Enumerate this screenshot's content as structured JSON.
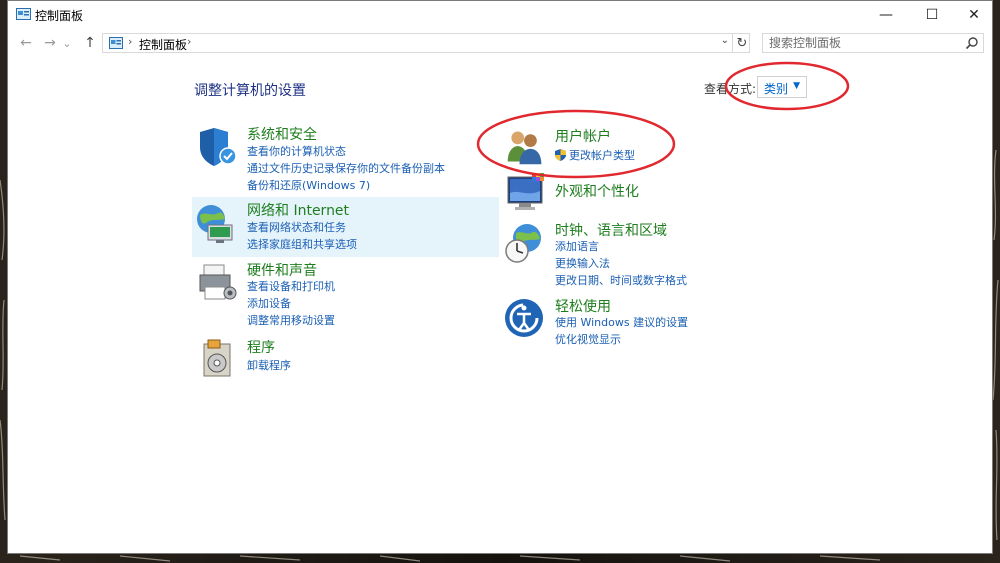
{
  "window": {
    "title": "控制面板",
    "controls": {
      "minimize": "—",
      "maximize": "☐",
      "close": "✕"
    }
  },
  "nav": {
    "back": "←",
    "forward": "→",
    "recent": "⌄",
    "up": "↑",
    "address_text": "控制面板",
    "address_chevron": "›",
    "dropdown": "⌄",
    "refresh": "↻",
    "search_placeholder": "搜索控制面板"
  },
  "main": {
    "heading": "调整计算机的设置",
    "view_by_label": "查看方式:",
    "view_by_value": "类别",
    "view_by_arrow": "▼"
  },
  "categories_left": [
    {
      "title": "系统和安全",
      "icon": "shield-icon",
      "links": [
        "查看你的计算机状态",
        "通过文件历史记录保存你的文件备份副本",
        "备份和还原(Windows 7)"
      ]
    },
    {
      "title": "网络和 Internet",
      "icon": "network-globe-icon",
      "links": [
        "查看网络状态和任务",
        "选择家庭组和共享选项"
      ]
    },
    {
      "title": "硬件和声音",
      "icon": "printer-icon",
      "links": [
        "查看设备和打印机",
        "添加设备",
        "调整常用移动设置"
      ]
    },
    {
      "title": "程序",
      "icon": "programs-icon",
      "links": [
        "卸载程序"
      ]
    }
  ],
  "categories_right": [
    {
      "title": "用户帐户",
      "icon": "users-icon",
      "links": [
        "更改帐户类型"
      ]
    },
    {
      "title": "外观和个性化",
      "icon": "monitor-icon",
      "links": []
    },
    {
      "title": "时钟、语言和区域",
      "icon": "clock-globe-icon",
      "links": [
        "添加语言",
        "更换输入法",
        "更改日期、时间或数字格式"
      ]
    },
    {
      "title": "轻松使用",
      "icon": "ease-of-access-icon",
      "links": [
        "使用 Windows 建议的设置",
        "优化视觉显示"
      ]
    }
  ],
  "colors": {
    "heading": "#1e3287",
    "category_title": "#1e7e1e",
    "link": "#1a5fb4",
    "highlight": "#e5f3fb",
    "annotation": "#e0282e"
  }
}
